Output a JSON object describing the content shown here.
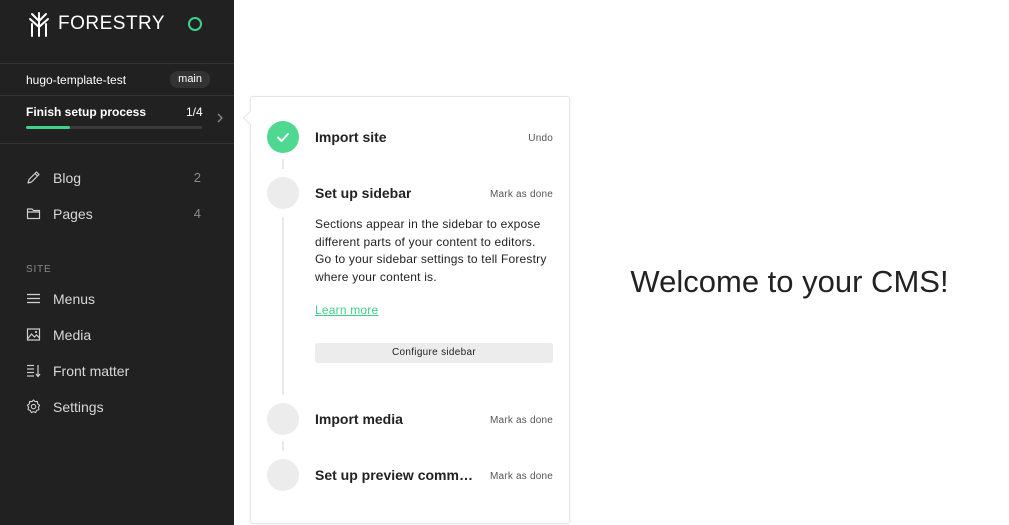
{
  "brand": {
    "name": "FORESTRY",
    "logo_icon": "forestry-tree-icon",
    "status_icon": "status-ring-icon",
    "accent_color": "#3fd08a"
  },
  "site": {
    "name": "hugo-template-test",
    "branch": "main"
  },
  "setup": {
    "title": "Finish setup process",
    "progress_text": "1/4",
    "progress_fraction": 0.25
  },
  "nav": {
    "content_items": [
      {
        "label": "Blog",
        "count": "2",
        "icon": "pencil-icon"
      },
      {
        "label": "Pages",
        "count": "4",
        "icon": "folder-icon"
      }
    ],
    "site_section_label": "SITE",
    "site_items": [
      {
        "label": "Menus",
        "icon": "menu-icon"
      },
      {
        "label": "Media",
        "icon": "image-icon"
      },
      {
        "label": "Front matter",
        "icon": "front-matter-icon"
      },
      {
        "label": "Settings",
        "icon": "gear-icon"
      }
    ]
  },
  "checklist": {
    "steps": [
      {
        "title": "Import site",
        "action": "Undo",
        "done": true
      },
      {
        "title": "Set up sidebar",
        "action": "Mark as done",
        "done": false,
        "description": "Sections appear in the sidebar to expose different parts of your content to editors. Go to your sidebar settings to tell Forestry where your content is.",
        "link": "Learn more",
        "button": "Configure sidebar"
      },
      {
        "title": "Import media",
        "action": "Mark as done",
        "done": false
      },
      {
        "title": "Set up preview command",
        "action": "Mark as done",
        "done": false
      }
    ]
  },
  "main": {
    "welcome": "Welcome to your CMS!"
  }
}
